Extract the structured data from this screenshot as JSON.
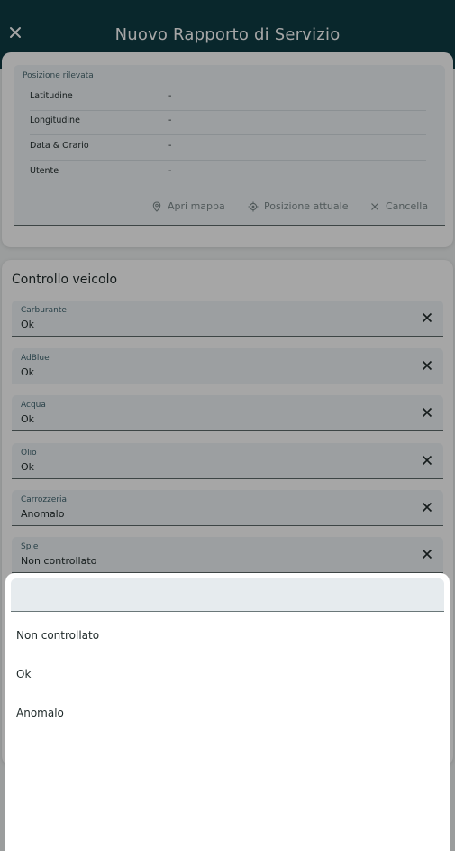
{
  "appbar": {
    "title": "Nuovo Rapporto di Servizio",
    "close_icon": "close-icon",
    "bg_color": "#0f3c44"
  },
  "position": {
    "legend": "Posizione rilevata",
    "rows": [
      {
        "label": "Latitudine",
        "value": "-"
      },
      {
        "label": "Longitudine",
        "value": "-"
      },
      {
        "label": "Data & Orario",
        "value": "-"
      },
      {
        "label": "Utente",
        "value": "-"
      }
    ],
    "actions": {
      "open_map": "Apri mappa",
      "current_position": "Posizione attuale",
      "cancel": "Cancella"
    }
  },
  "vehicle_check": {
    "title": "Controllo veicolo",
    "fields": [
      {
        "label": "Carburante",
        "value": "Ok"
      },
      {
        "label": "AdBlue",
        "value": "Ok"
      },
      {
        "label": "Acqua",
        "value": "Ok"
      },
      {
        "label": "Olio",
        "value": "Ok"
      },
      {
        "label": "Carrozzeria",
        "value": "Anomalo"
      },
      {
        "label": "Spie",
        "value": "Non controllato"
      }
    ]
  },
  "picker": {
    "search_value": "",
    "options": [
      "Non controllato",
      "Ok",
      "Anomalo"
    ]
  }
}
